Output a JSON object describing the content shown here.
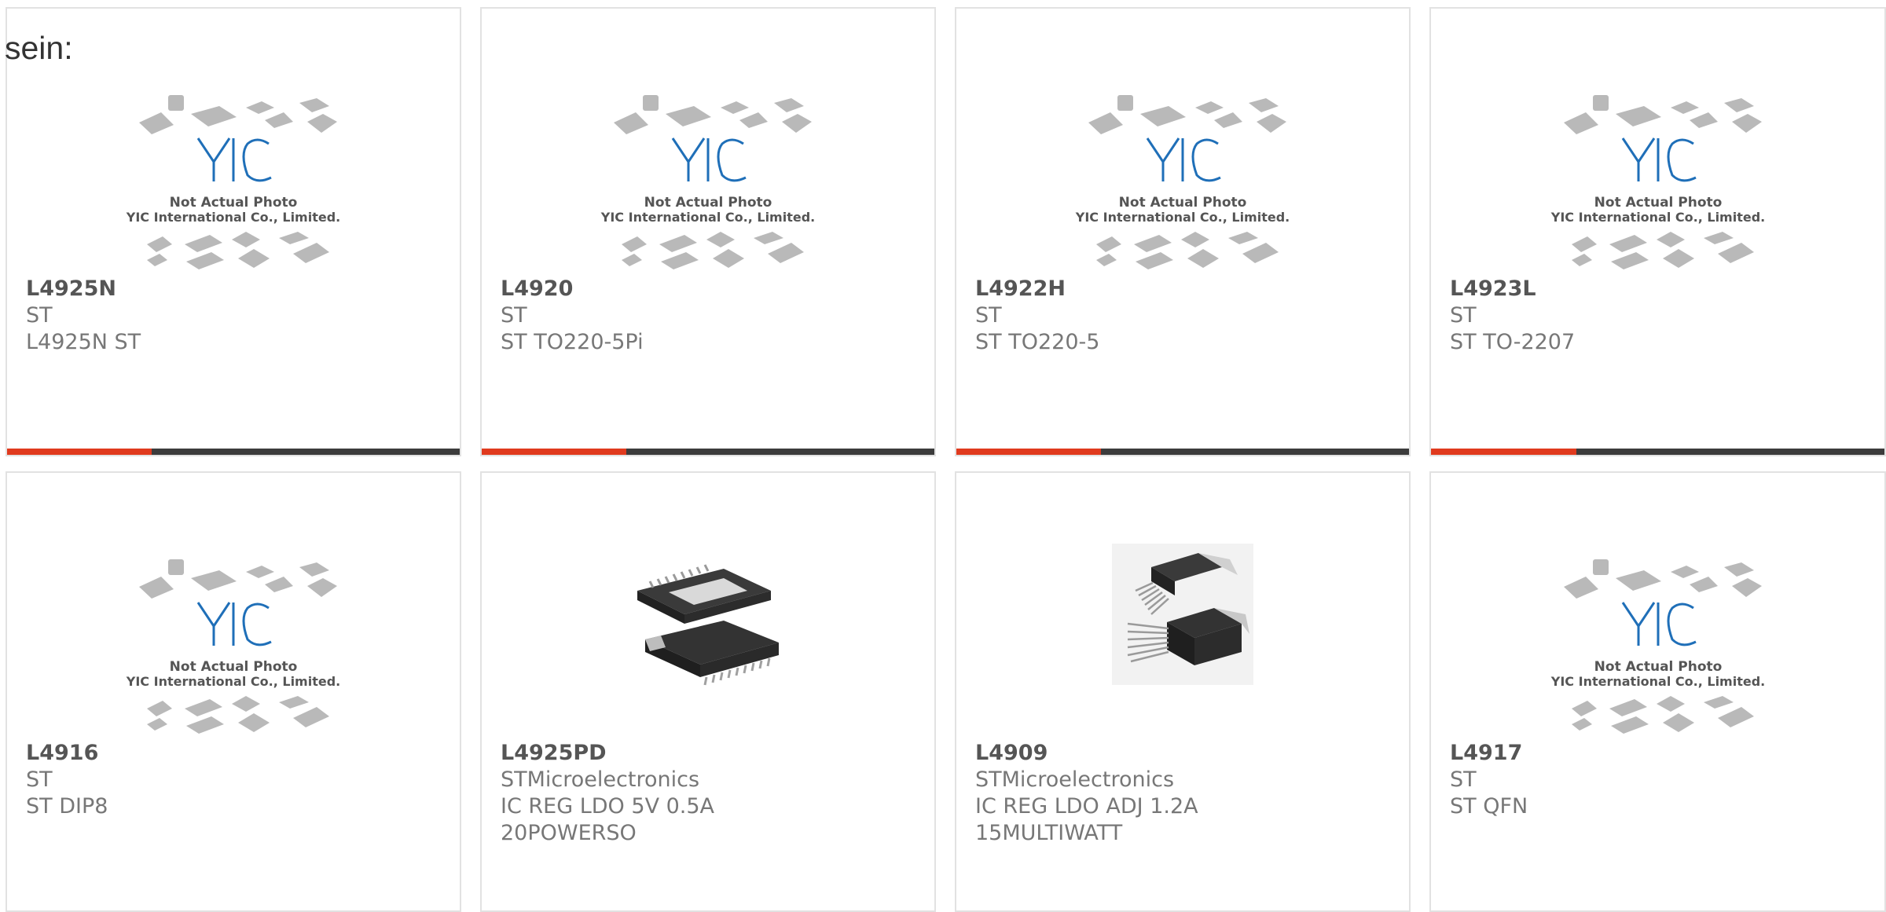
{
  "intro_text": "sein:",
  "placeholder": {
    "line1": "Not Actual Photo",
    "line2": "YIC International Co., Limited."
  },
  "products": [
    {
      "part": "L4925N",
      "mfr": "ST",
      "desc": "L4925N ST",
      "image": "placeholder"
    },
    {
      "part": "L4920",
      "mfr": "ST",
      "desc": "ST TO220-5Pi",
      "image": "placeholder"
    },
    {
      "part": "L4922H",
      "mfr": "ST",
      "desc": "ST TO220-5",
      "image": "placeholder"
    },
    {
      "part": "L4923L",
      "mfr": "ST",
      "desc": "ST TO-2207",
      "image": "placeholder"
    },
    {
      "part": "L4916",
      "mfr": "ST",
      "desc": "ST DIP8",
      "image": "placeholder"
    },
    {
      "part": "L4925PD",
      "mfr": "STMicroelectronics",
      "desc": "IC REG LDO 5V 0.5A 20POWERSO",
      "image": "powerso-photo"
    },
    {
      "part": "L4909",
      "mfr": "STMicroelectronics",
      "desc": "IC REG LDO ADJ 1.2A 15MULTIWATT",
      "image": "multiwatt-photo"
    },
    {
      "part": "L4917",
      "mfr": "ST",
      "desc": "ST QFN",
      "image": "placeholder"
    }
  ],
  "colors": {
    "accent_red": "#e03a1e",
    "accent_dark": "#3c3c3c",
    "logo_blue": "#1f6fb8"
  }
}
